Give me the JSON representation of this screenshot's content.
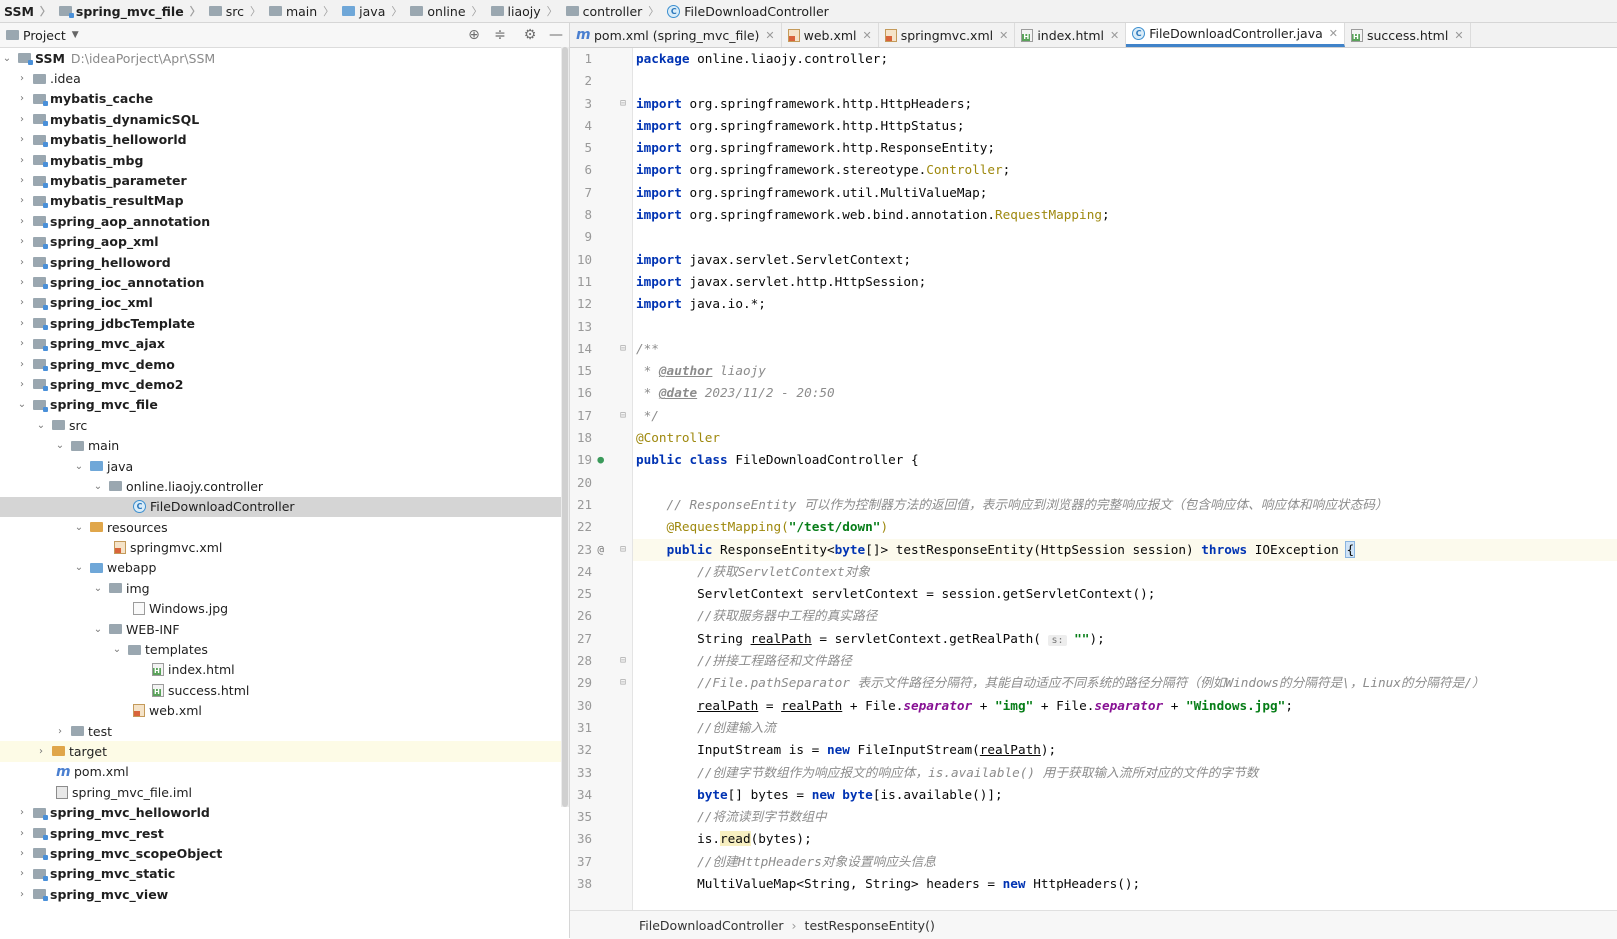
{
  "breadcrumb": [
    "SSM",
    "spring_mvc_file",
    "src",
    "main",
    "java",
    "online",
    "liaojy",
    "controller",
    "FileDownloadController"
  ],
  "project": {
    "title": "Project",
    "root_name": "SSM",
    "root_path": "D:\\ideaPorject\\Apr\\SSM",
    "items": [
      {
        "label": ".idea"
      },
      {
        "label": "mybatis_cache"
      },
      {
        "label": "mybatis_dynamicSQL"
      },
      {
        "label": "mybatis_helloworld"
      },
      {
        "label": "mybatis_mbg"
      },
      {
        "label": "mybatis_parameter"
      },
      {
        "label": "mybatis_resultMap"
      },
      {
        "label": "spring_aop_annotation"
      },
      {
        "label": "spring_aop_xml"
      },
      {
        "label": "spring_helloword"
      },
      {
        "label": "spring_ioc_annotation"
      },
      {
        "label": "spring_ioc_xml"
      },
      {
        "label": "spring_jdbcTemplate"
      },
      {
        "label": "spring_mvc_ajax"
      },
      {
        "label": "spring_mvc_demo"
      },
      {
        "label": "spring_mvc_demo2"
      },
      {
        "label": "spring_mvc_file"
      },
      {
        "label": "src"
      },
      {
        "label": "main"
      },
      {
        "label": "java"
      },
      {
        "label": "online.liaojy.controller"
      },
      {
        "label": "FileDownloadController"
      },
      {
        "label": "resources"
      },
      {
        "label": "springmvc.xml"
      },
      {
        "label": "webapp"
      },
      {
        "label": "img"
      },
      {
        "label": "Windows.jpg"
      },
      {
        "label": "WEB-INF"
      },
      {
        "label": "templates"
      },
      {
        "label": "index.html"
      },
      {
        "label": "success.html"
      },
      {
        "label": "web.xml"
      },
      {
        "label": "test"
      },
      {
        "label": "target"
      },
      {
        "label": "pom.xml"
      },
      {
        "label": "spring_mvc_file.iml"
      },
      {
        "label": "spring_mvc_helloworld"
      },
      {
        "label": "spring_mvc_rest"
      },
      {
        "label": "spring_mvc_scopeObject"
      },
      {
        "label": "spring_mvc_static"
      },
      {
        "label": "spring_mvc_view"
      }
    ]
  },
  "tabs": [
    {
      "label": "pom.xml (spring_mvc_file)"
    },
    {
      "label": "web.xml"
    },
    {
      "label": "springmvc.xml"
    },
    {
      "label": "index.html"
    },
    {
      "label": "FileDownloadController.java"
    },
    {
      "label": "success.html"
    }
  ],
  "code": {
    "line_numbers": [
      "1",
      "2",
      "3",
      "4",
      "5",
      "6",
      "7",
      "8",
      "9",
      "10",
      "11",
      "12",
      "13",
      "14",
      "15",
      "16",
      "17",
      "18",
      "19",
      "20",
      "21",
      "22",
      "23",
      "24",
      "25",
      "26",
      "27",
      "28",
      "29",
      "30",
      "31",
      "32",
      "33",
      "34",
      "35",
      "36",
      "37",
      "38"
    ],
    "l1_kw": "package",
    "l1_rest": " online.liaojy.controller;",
    "imp": "import",
    "l3": " org.springframework.http.HttpHeaders;",
    "l4": " org.springframework.http.HttpStatus;",
    "l5": " org.springframework.http.ResponseEntity;",
    "l6a": " org.springframework.stereotype.",
    "l6b": "Controller",
    "l6c": ";",
    "l7": " org.springframework.util.MultiValueMap;",
    "l8a": " org.springframework.web.bind.annotation.",
    "l8b": "RequestMapping",
    "l8c": ";",
    "l10": " javax.servlet.ServletContext;",
    "l11": " javax.servlet.http.HttpSession;",
    "l12": " java.io.*;",
    "l14": "/**",
    "l15a": " * ",
    "l15b": "@author",
    "l15c": " liaojy",
    "l16a": " * ",
    "l16b": "@date",
    "l16c": " 2023/11/2 - 20:50",
    "l17": " */",
    "l18": "@Controller",
    "l19a": "public",
    "l19b": "class",
    "l19c": " FileDownloadController {",
    "l21": "    // ResponseEntity 可以作为控制器方法的返回值，表示响应到浏览器的完整响应报文（包含响应体、响应体和响应状态码）",
    "l22a": "    @RequestMapping(",
    "l22b": "\"/test/down\"",
    "l22c": ")",
    "l23a": "public",
    "l23b": " ResponseEntity<",
    "l23c": "byte",
    "l23d": "[]> testResponseEntity(HttpSession session) ",
    "l23e": "throws",
    "l23f": " IOException ",
    "l23g": "{",
    "l24": "        //获取ServletContext对象",
    "l25": "        ServletContext servletContext = session.getServletContext();",
    "l26": "        //获取服务器中工程的真实路径",
    "l27a": "        String ",
    "l27b": "realPath",
    "l27c": " = servletContext.getRealPath( ",
    "l27hint": "s:",
    "l27d": " ",
    "l27e": "\"\"",
    "l27f": ");",
    "l28": "        //拼接工程路径和文件路径",
    "l29": "        //File.pathSeparator 表示文件路径分隔符，其能自动适应不同系统的路径分隔符（例如Windows的分隔符是\\，Linux的分隔符是/）",
    "l30a": "realPath",
    "l30b": " = ",
    "l30c": "realPath",
    "l30d": " + File.",
    "l30e": "separator",
    "l30f": " + ",
    "l30g": "\"img\"",
    "l30h": " + File.",
    "l30i": "separator",
    "l30j": " + ",
    "l30k": "\"Windows.jpg\"",
    "l30l": ";",
    "l31": "        //创建输入流",
    "l32a": "        InputStream is = ",
    "l32b": "new",
    "l32c": " FileInputStream(",
    "l32d": "realPath",
    "l32e": ");",
    "l33": "        //创建字节数组作为响应报文的响应体，is.available() 用于获取输入流所对应的文件的字节数",
    "l34a": "byte",
    "l34b": "[] bytes = ",
    "l34c": "new",
    "l34d": " ",
    "l34e": "byte",
    "l34f": "[is.available()];",
    "l35": "        //将流读到字节数组中",
    "l36a": "        is.",
    "l36b": "read",
    "l36c": "(bytes);",
    "l37": "        //创建HttpHeaders对象设置响应头信息",
    "l38a": "        MultiValueMap<String, String> headers = ",
    "l38b": "new",
    "l38c": " HttpHeaders();"
  },
  "status": {
    "class": "FileDownloadController",
    "method": "testResponseEntity()"
  },
  "colors": {
    "keyword": "#0033b3",
    "string": "#067d17",
    "annotation": "#9e880d",
    "comment": "#8c8c8c",
    "accent": "#4083c9"
  }
}
